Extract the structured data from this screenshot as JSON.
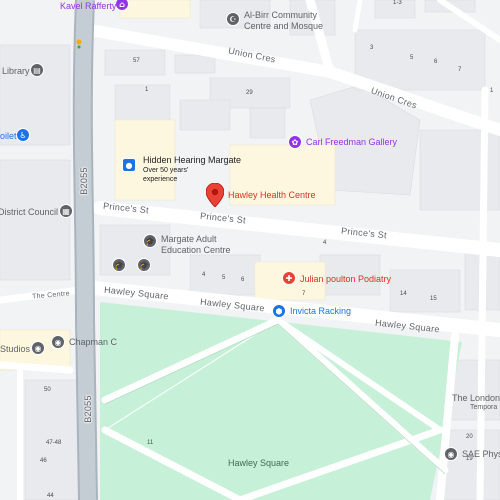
{
  "colors": {
    "background": "#f1f3f4",
    "road": "#ffffff",
    "major_road": "#aab4be",
    "building": "#e8eaed",
    "park": "#c7f0d8",
    "health_pin": "#ea4335",
    "service_pin": "#1a73e8",
    "culture_pin": "#9334e6",
    "grey_pin": "#5f6368"
  },
  "roads": {
    "union_cres_top": "Union Cres",
    "union_cres_right": "Union Cres",
    "b2055_upper": "B2055",
    "b2055_lower": "B2055",
    "princes_st_left": "Prince's St",
    "princes_st_mid": "Prince's St",
    "princes_st_right": "Prince's St",
    "hawley_square_left": "Hawley Square",
    "hawley_square_mid": "Hawley Square",
    "hawley_square_right": "Hawley Square",
    "the_centre": "The Centre"
  },
  "pois": {
    "kavel_rafferty": "Kavel Rafferty",
    "al_birr": "Al-Birr Community\nCentre and Mosque",
    "library": "Library",
    "toilet": "oilet",
    "carl_freedman": "Carl Freedman Gallery",
    "hidden_hearing": "Hidden Hearing Margate",
    "hidden_hearing_sub": "Over 50 years'\nexperience",
    "hawley_health": "Hawley Health Centre",
    "district_council": "District Council",
    "margate_adult": "Margate Adult\nEducation Centre",
    "julian_poulton": "Julian poulton Podiatry",
    "invicta_racking": "Invicta Racking",
    "studios": "Studios",
    "chapman": "Chapman C",
    "the_london": "The London",
    "the_london_sub": "Tempora",
    "sae_phys": "SAE Phys",
    "park_name": "Hawley Square"
  },
  "house_numbers": {
    "n57": "57",
    "n1a": "1",
    "n29": "29",
    "n13": "1-3",
    "n3": "3",
    "n5": "5",
    "n6": "6",
    "n7a": "7",
    "n4a": "4",
    "n4b": "4",
    "n5b": "5",
    "n6b": "6",
    "n7b": "7",
    "n14": "14",
    "n15": "15",
    "n50": "50",
    "n4748": "47-48",
    "n46": "46",
    "n44": "44",
    "n11": "11",
    "n1b": "1",
    "n20": "20",
    "n19": "19"
  }
}
